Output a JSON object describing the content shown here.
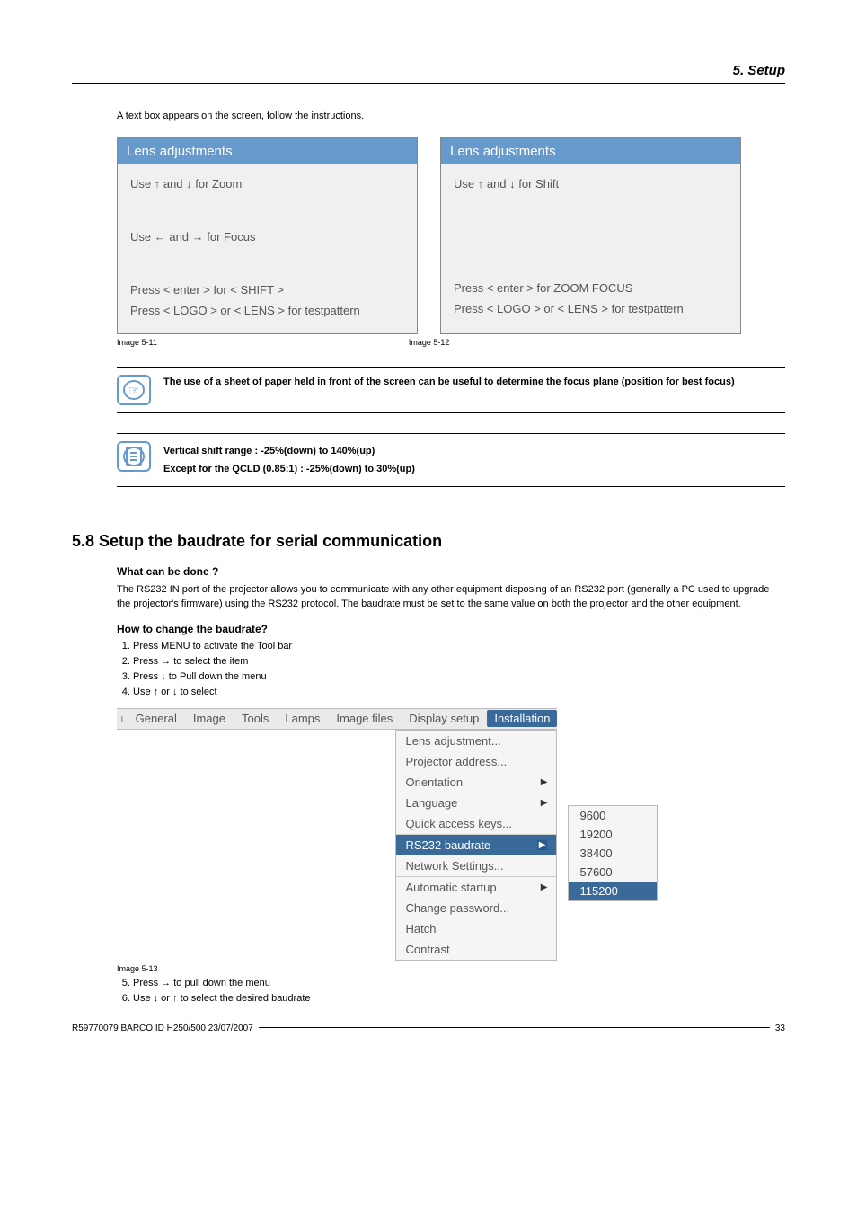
{
  "header": {
    "section": "5.  Setup"
  },
  "intro": "A text box appears on the screen, follow the instructions.",
  "panel1": {
    "title": "Lens adjustments",
    "line1": "Use ↑ and ↓ for Zoom",
    "line2": "Use ← and → for Focus",
    "line3": "Press < enter > for < SHIFT >",
    "line4": "Press < LOGO > or < LENS > for testpattern"
  },
  "panel2": {
    "title": "Lens adjustments",
    "line1": "Use ↑ and ↓ for Shift",
    "line3": "Press < enter > for ZOOM FOCUS",
    "line4": "Press < LOGO > or < LENS > for testpattern"
  },
  "captions": {
    "c511": "Image 5-11",
    "c512": "Image 5-12",
    "c513": "Image 5-13"
  },
  "note1": "The use of a sheet of paper held in front of the screen can be useful to determine the focus plane (position for best focus)",
  "note2a": "Vertical shift range :  -25%(down) to 140%(up)",
  "note2b": "Except for the QCLD (0.85:1) :  -25%(down) to 30%(up)",
  "section58": {
    "heading": "5.8   Setup the baudrate for serial communication",
    "sub1": "What can be done ?",
    "para1": "The RS232 IN port of the projector allows you to communicate with any other equipment disposing of an RS232 port (generally a PC used to upgrade the projector's firmware) using the RS232 protocol.  The baudrate must be set to the same value on both the projector and the other equipment.",
    "sub2": "How to change the baudrate?",
    "steps_a": [
      "Press MENU to activate the Tool bar",
      "Press → to select the                       item",
      "Press ↓ to Pull down the                            menu",
      "Use ↑ or ↓ to select"
    ],
    "steps_b": [
      "Press → to pull down the menu",
      "Use ↓ or ↑ to select the desired baudrate"
    ]
  },
  "menubar": [
    "General",
    "Image",
    "Tools",
    "Lamps",
    "Image files",
    "Display setup",
    "Installation"
  ],
  "dropdown": [
    {
      "label": "Lens adjustment...",
      "arrow": false
    },
    {
      "label": "Projector address...",
      "arrow": false
    },
    {
      "label": "Orientation",
      "arrow": true
    },
    {
      "label": "Language",
      "arrow": true
    },
    {
      "label": "Quick access keys...",
      "arrow": false
    },
    {
      "label": "RS232 baudrate",
      "arrow": true,
      "selected": true,
      "sepBefore": true
    },
    {
      "label": "Network Settings...",
      "arrow": false
    },
    {
      "label": "Automatic startup",
      "arrow": true,
      "sepBefore": true
    },
    {
      "label": "Change password...",
      "arrow": false
    },
    {
      "label": "Hatch",
      "arrow": false
    },
    {
      "label": "Contrast",
      "arrow": false
    }
  ],
  "submenu": [
    {
      "label": "9600"
    },
    {
      "label": "19200"
    },
    {
      "label": "38400"
    },
    {
      "label": "57600"
    },
    {
      "label": "115200",
      "selected": true
    }
  ],
  "footer": {
    "left": "R59770079  BARCO ID H250/500  23/07/2007",
    "right": "33"
  }
}
